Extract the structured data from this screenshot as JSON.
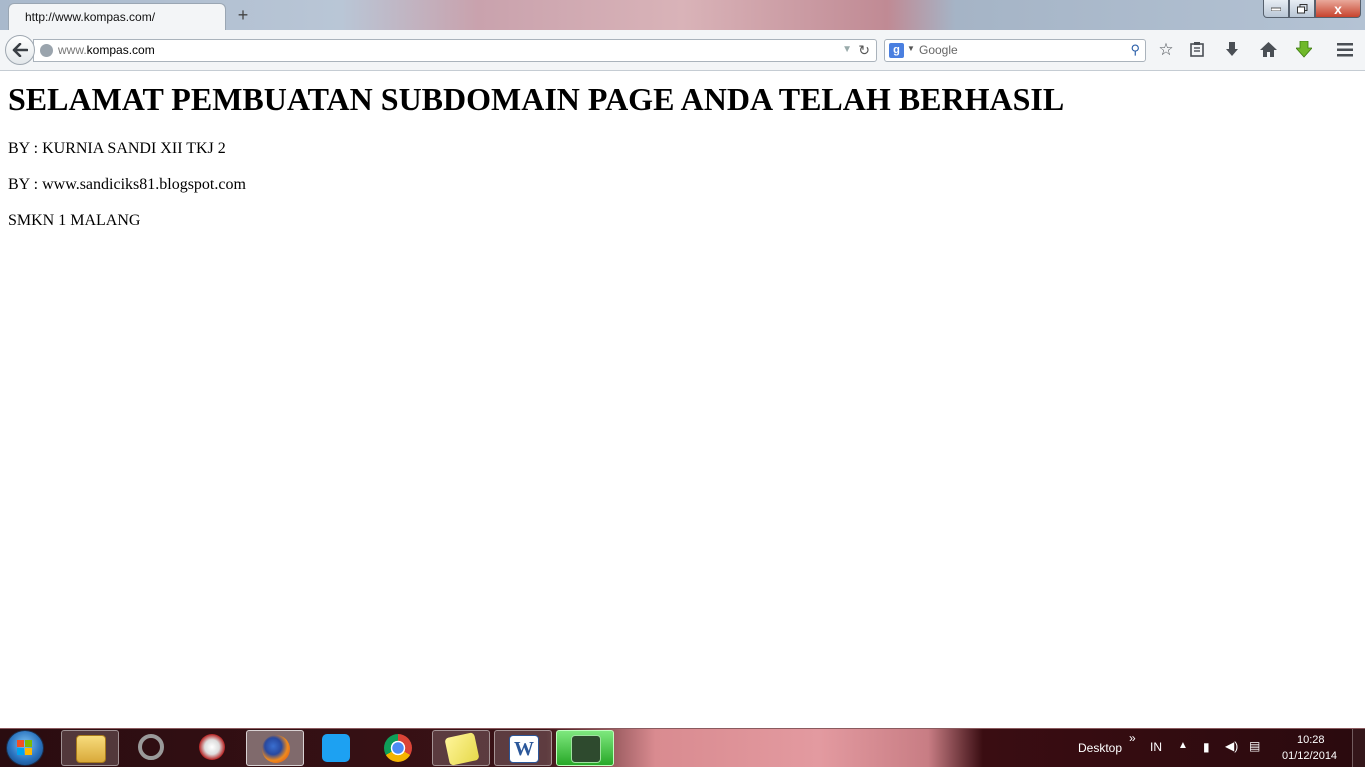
{
  "browser": {
    "tab_title": "http://www.kompas.com/",
    "new_tab_symbol": "+",
    "url_prefix": "www.",
    "url_domain": "kompas.com",
    "search_engine": "Google",
    "search_placeholder": "Google",
    "window_controls": {
      "close_label": "x"
    }
  },
  "page": {
    "heading": "SELAMAT PEMBUATAN SUBDOMAIN PAGE ANDA TELAH BERHASIL",
    "lines": [
      "BY : KURNIA SANDI XII TKJ 2",
      "BY : www.sandiciks81.blogspot.com",
      "SMKN 1 MALANG"
    ]
  },
  "taskbar": {
    "apps": [
      {
        "name": "windows-explorer",
        "icon": "folder-icon",
        "state": "open"
      },
      {
        "name": "ccleaner",
        "icon": "ccleaner-icon",
        "state": "pinned"
      },
      {
        "name": "download-manager",
        "icon": "idm-icon",
        "state": "pinned"
      },
      {
        "name": "firefox",
        "icon": "firefox-icon",
        "state": "active"
      },
      {
        "name": "twitter",
        "icon": "twitter-icon",
        "state": "pinned"
      },
      {
        "name": "chrome",
        "icon": "chrome-icon",
        "state": "pinned"
      },
      {
        "name": "sticky-notes",
        "icon": "sticky-notes-icon",
        "state": "open"
      },
      {
        "name": "word",
        "icon": "word-icon",
        "state": "open"
      },
      {
        "name": "camtasia",
        "icon": "recorder-icon",
        "state": "open"
      }
    ],
    "desktop_label": "Desktop",
    "language": "IN",
    "time": "10:28",
    "date": "01/12/2014"
  }
}
